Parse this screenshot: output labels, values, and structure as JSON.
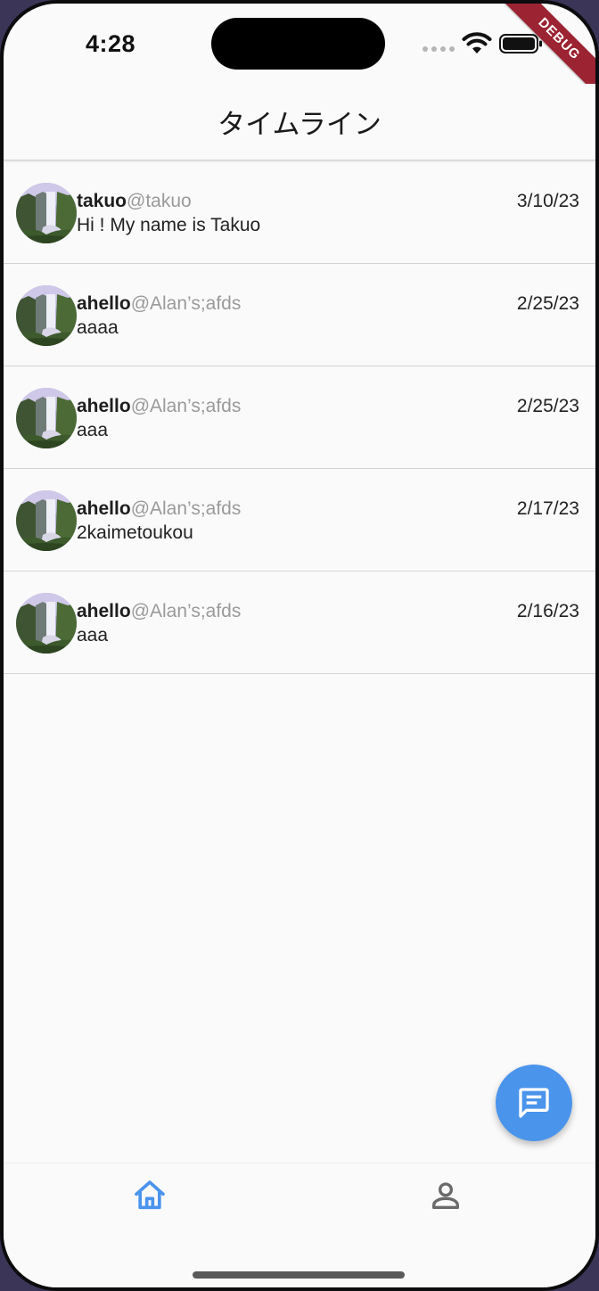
{
  "status_bar": {
    "time": "4:28"
  },
  "debug_banner": "DEBUG",
  "header": {
    "title": "タイムライン"
  },
  "posts": [
    {
      "name": "takuo",
      "handle": "@takuo",
      "date": "3/10/23",
      "text": "Hi ! My name is Takuo"
    },
    {
      "name": "ahello",
      "handle": "@Alan’s;afds",
      "date": "2/25/23",
      "text": "aaaa"
    },
    {
      "name": "ahello",
      "handle": "@Alan’s;afds",
      "date": "2/25/23",
      "text": "aaa"
    },
    {
      "name": "ahello",
      "handle": "@Alan’s;afds",
      "date": "2/17/23",
      "text": "2kaimetoukou"
    },
    {
      "name": "ahello",
      "handle": "@Alan’s;afds",
      "date": "2/16/23",
      "text": "aaa"
    }
  ],
  "fab": {
    "icon": "chat-bubble-icon",
    "color": "#4a94ec"
  },
  "bottom_nav": {
    "items": [
      {
        "icon": "home-icon",
        "active": true,
        "color": "#4a94ec"
      },
      {
        "icon": "person-icon",
        "active": false,
        "color": "#6a6a6a"
      }
    ]
  }
}
